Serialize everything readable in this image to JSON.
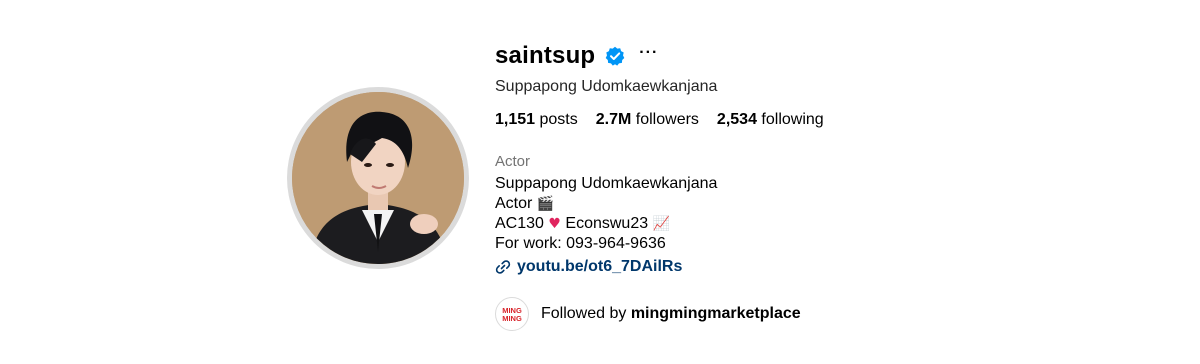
{
  "profile": {
    "username": "saintsup",
    "verified_icon": "verified-badge-icon",
    "more_label": "···",
    "full_name": "Suppapong Udomkaewkanjana",
    "stats": {
      "posts_count": "1,151",
      "posts_label": "posts",
      "followers_count": "2.7M",
      "followers_label": "followers",
      "following_count": "2,534",
      "following_label": "following"
    },
    "category": "Actor",
    "bio": {
      "line1": "Suppapong Udomkaewkanjana",
      "line2_text": "Actor",
      "line2_emoji": "clapper-board-emoji",
      "line3_a": "AC130",
      "line3_heart": "heart-emoji",
      "line3_b": "Econswu23",
      "line3_chart": "chart-increasing-emoji",
      "line4": "For work: 093-964-9636"
    },
    "link_text": "youtu.be/ot6_7DAilRs",
    "followed_by_prefix": "Followed by",
    "followed_by_user": "mingmingmarketplace",
    "followed_avatar_text": "MING MING"
  },
  "colors": {
    "verified_blue": "#0095f6",
    "link_blue": "#00376b",
    "muted_gray": "#737373",
    "ring_gray": "#dbdbdb",
    "heart_red": "#e0245e"
  }
}
